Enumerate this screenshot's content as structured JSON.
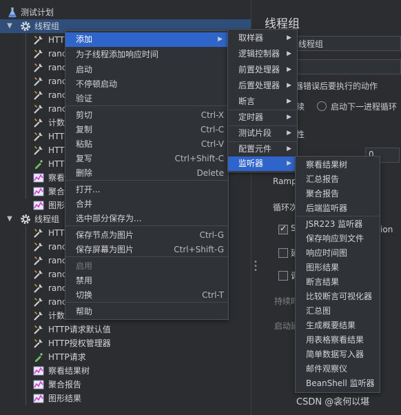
{
  "tree": {
    "root": {
      "label": "测试计划",
      "icon": "flask-icon"
    },
    "group1": {
      "label": "线程组",
      "icon": "gear-icon",
      "expanded": true
    },
    "group1_children": [
      {
        "label": "HTTP",
        "icon": "wrench-icon"
      },
      {
        "label": "ranc",
        "icon": "wrench-icon"
      },
      {
        "label": "ranc",
        "icon": "wrench-icon"
      },
      {
        "label": "ranc",
        "icon": "wrench-icon"
      },
      {
        "label": "ranc",
        "icon": "wrench-icon"
      },
      {
        "label": "ranc",
        "icon": "wrench-icon"
      },
      {
        "label": "计数",
        "icon": "wrench-icon"
      },
      {
        "label": "HTTP",
        "icon": "wrench-icon"
      },
      {
        "label": "HTTP",
        "icon": "wrench-icon"
      },
      {
        "label": "HTTP",
        "icon": "pipette-icon"
      },
      {
        "label": "察看",
        "icon": "chart-icon"
      },
      {
        "label": "聚合",
        "icon": "chart-icon"
      },
      {
        "label": "图形",
        "icon": "chart-icon"
      }
    ],
    "group2": {
      "label": "线程组",
      "icon": "gear-icon",
      "expanded": true
    },
    "group2_children": [
      {
        "label": "HTTP",
        "icon": "wrench-icon"
      },
      {
        "label": "ranc",
        "icon": "wrench-icon"
      },
      {
        "label": "ranc",
        "icon": "wrench-icon"
      },
      {
        "label": "ranc",
        "icon": "wrench-icon"
      },
      {
        "label": "ranc",
        "icon": "wrench-icon"
      },
      {
        "label": "ranc",
        "icon": "wrench-icon"
      },
      {
        "label": "计数器",
        "icon": "wrench-icon"
      },
      {
        "label": "HTTP请求默认值",
        "icon": "wrench-icon"
      },
      {
        "label": "HTTP授权管理器",
        "icon": "wrench-icon"
      },
      {
        "label": "HTTP请求",
        "icon": "pipette-icon"
      },
      {
        "label": "察看结果树",
        "icon": "chart-icon"
      },
      {
        "label": "聚合报告",
        "icon": "chart-icon"
      },
      {
        "label": "图形结果",
        "icon": "chart-icon"
      }
    ]
  },
  "right_panel": {
    "title": "线程组",
    "name_value": "线程组",
    "error_action_label": "器错误后要执行的动作",
    "continue_label": "续",
    "next_loop_label": "启动下一进程循环",
    "props_label": "性",
    "threads_value": "0",
    "ramp_label": "Ramp",
    "loop_label": "循环次",
    "same_user_label": "S",
    "same_user_suffix": "ation",
    "delay_label": "延",
    "scheduler_label": "调",
    "duration_label": "持续时",
    "startup_delay_label": "启动延"
  },
  "context_menu": {
    "items": [
      {
        "label": "添加",
        "shortcut": "",
        "submenu": true,
        "highlighted": true
      },
      {
        "label": "为子线程添加响应时间",
        "shortcut": ""
      },
      {
        "label": "启动",
        "shortcut": ""
      },
      {
        "label": "不停顿启动",
        "shortcut": ""
      },
      {
        "label": "验证",
        "shortcut": ""
      },
      {
        "label": "剪切",
        "shortcut": "Ctrl-X"
      },
      {
        "label": "复制",
        "shortcut": "Ctrl-C"
      },
      {
        "label": "粘贴",
        "shortcut": "Ctrl-V"
      },
      {
        "label": "复写",
        "shortcut": "Ctrl+Shift-C"
      },
      {
        "label": "删除",
        "shortcut": "Delete"
      },
      {
        "label": "打开...",
        "shortcut": ""
      },
      {
        "label": "合并",
        "shortcut": ""
      },
      {
        "label": "选中部分保存为...",
        "shortcut": ""
      },
      {
        "label": "保存节点为图片",
        "shortcut": "Ctrl-G"
      },
      {
        "label": "保存屏幕为图片",
        "shortcut": "Ctrl+Shift-G"
      },
      {
        "label": "启用",
        "shortcut": "",
        "disabled": true
      },
      {
        "label": "禁用",
        "shortcut": ""
      },
      {
        "label": "切换",
        "shortcut": "Ctrl-T"
      },
      {
        "label": "帮助",
        "shortcut": ""
      }
    ]
  },
  "add_submenu": {
    "items": [
      {
        "label": "取样器"
      },
      {
        "label": "逻辑控制器"
      },
      {
        "label": "前置处理器"
      },
      {
        "label": "后置处理器"
      },
      {
        "label": "断言"
      },
      {
        "label": "定时器"
      },
      {
        "label": "测试片段"
      },
      {
        "label": "配置元件"
      },
      {
        "label": "监听器",
        "highlighted": true
      }
    ]
  },
  "listener_submenu": {
    "items": [
      {
        "label": "察看结果树"
      },
      {
        "label": "汇总报告"
      },
      {
        "label": "聚合报告"
      },
      {
        "label": "后端监听器"
      },
      {
        "label": "JSR223 监听器"
      },
      {
        "label": "保存响应到文件"
      },
      {
        "label": "响应时间图"
      },
      {
        "label": "图形结果"
      },
      {
        "label": "断言结果"
      },
      {
        "label": "比较断言可视化器"
      },
      {
        "label": "汇总图"
      },
      {
        "label": "生成概要结果"
      },
      {
        "label": "用表格察看结果"
      },
      {
        "label": "简单数据写入器"
      },
      {
        "label": "邮件观察仪"
      },
      {
        "label": "BeanShell 监听器"
      }
    ]
  },
  "watermark": "CSDN @衾何以堪",
  "colors": {
    "background": "#2b2d30",
    "selection": "#2f4f7a",
    "menu_highlight": "#2f65ca",
    "menu_bg": "#2f3236"
  }
}
